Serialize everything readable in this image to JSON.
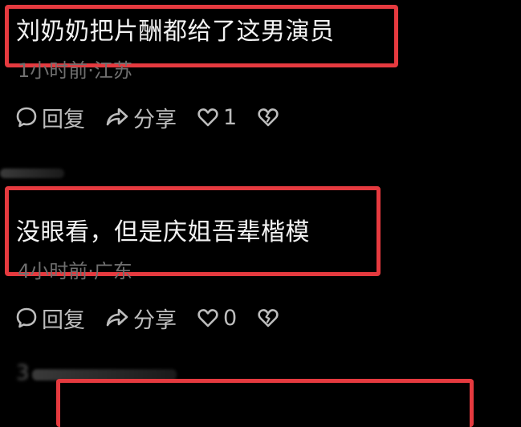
{
  "comments": [
    {
      "text": "刘奶奶把片酬都给了这男演员",
      "meta": "1小时前·江苏",
      "reply_label": "回复",
      "share_label": "分享",
      "like_count": "1"
    },
    {
      "text": "没眼看，但是庆姐吾辈楷模",
      "meta": "4小时前·广东",
      "reply_label": "回复",
      "share_label": "分享",
      "like_count": "0"
    }
  ],
  "partial_user": "3",
  "colors": {
    "highlight": "#e53a3f",
    "background": "#000000"
  },
  "icons": [
    "comment-bubble-icon",
    "share-arrow-icon",
    "heart-icon",
    "broken-heart-icon"
  ]
}
